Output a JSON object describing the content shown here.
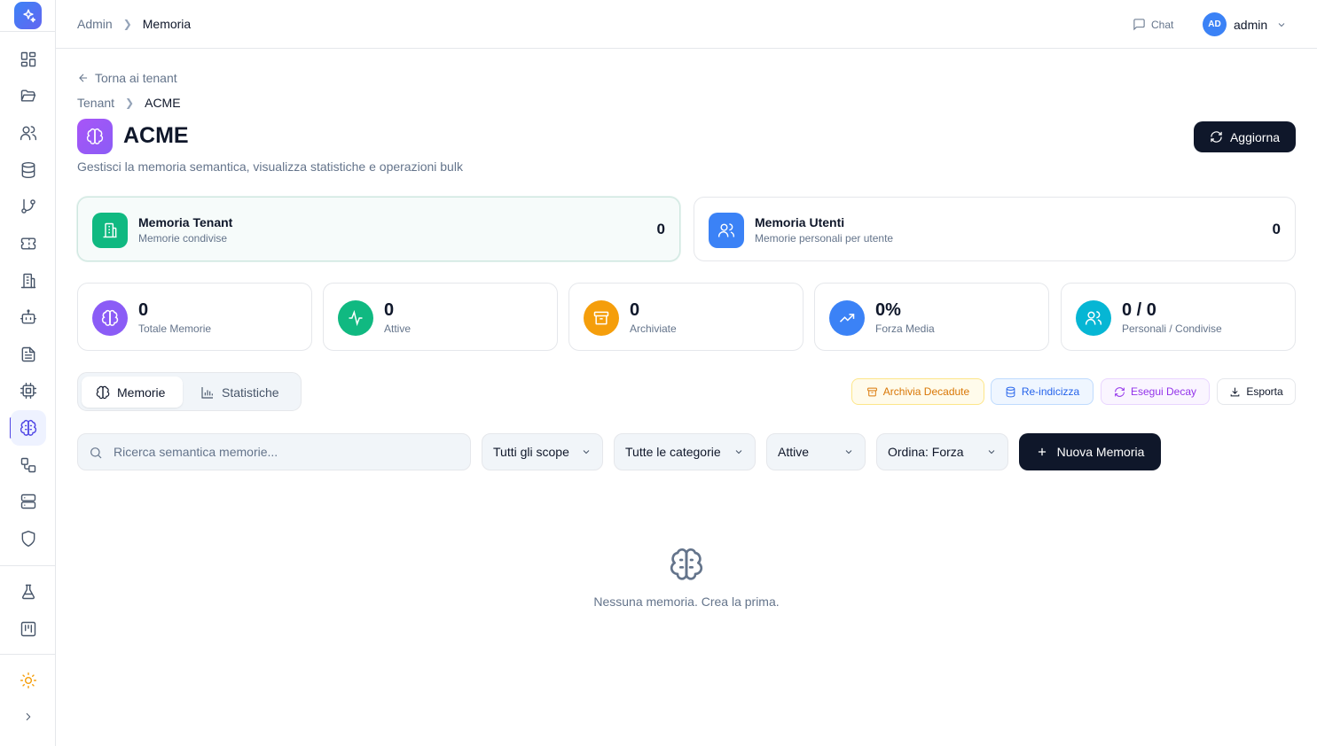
{
  "header": {
    "breadcrumb": [
      "Admin",
      "Memoria"
    ],
    "chat_label": "Chat",
    "user": {
      "initials": "AD",
      "name": "admin"
    }
  },
  "sidebar": {
    "items": [
      "dashboard",
      "projects",
      "users",
      "database",
      "git-branch",
      "tickets",
      "building",
      "bot",
      "documents",
      "chip",
      "memory",
      "workflow",
      "server",
      "shield",
      "lab",
      "kanban",
      "theme",
      "expand"
    ],
    "active": "memory"
  },
  "page": {
    "back_label": "Torna ai tenant",
    "breadcrumb": [
      "Tenant",
      "ACME"
    ],
    "title": "ACME",
    "subtitle": "Gestisci la memoria semantica, visualizza statistiche e operazioni bulk",
    "refresh_label": "Aggiorna"
  },
  "memory_cards": [
    {
      "title": "Memoria Tenant",
      "subtitle": "Memorie condivise",
      "value": "0",
      "color": "#10b981",
      "icon": "building-icon",
      "selected": true
    },
    {
      "title": "Memoria Utenti",
      "subtitle": "Memorie personali per utente",
      "value": "0",
      "color": "#3b82f6",
      "icon": "users-icon",
      "selected": false
    }
  ],
  "stats": [
    {
      "value": "0",
      "label": "Totale Memorie",
      "color": "#8b5cf6",
      "icon": "brain-icon"
    },
    {
      "value": "0",
      "label": "Attive",
      "color": "#10b981",
      "icon": "activity-icon"
    },
    {
      "value": "0",
      "label": "Archiviate",
      "color": "#f59e0b",
      "icon": "archive-icon"
    },
    {
      "value": "0%",
      "label": "Forza Media",
      "color": "#3b82f6",
      "icon": "trending-up-icon"
    },
    {
      "value": "0 / 0",
      "label": "Personali / Condivise",
      "color": "#06b6d4",
      "icon": "users-icon"
    }
  ],
  "tabs": [
    {
      "label": "Memorie",
      "active": true
    },
    {
      "label": "Statistiche",
      "active": false
    }
  ],
  "actions": [
    {
      "label": "Archivia Decadute",
      "color": "#d97706",
      "bg": "#fffbeb",
      "border": "#fde68a"
    },
    {
      "label": "Re-indicizza",
      "color": "#2563eb",
      "bg": "#eff6ff",
      "border": "#bfdbfe"
    },
    {
      "label": "Esegui Decay",
      "color": "#9333ea",
      "bg": "#faf5ff",
      "border": "#e9d5ff"
    },
    {
      "label": "Esporta",
      "color": "#0f172a",
      "bg": "#ffffff",
      "border": "#e5e7eb"
    }
  ],
  "filters": {
    "search_placeholder": "Ricerca semantica memorie...",
    "scope": "Tutti gli scope",
    "category": "Tutte le categorie",
    "status": "Attive",
    "order": "Ordina: Forza",
    "new_label": "Nuova Memoria"
  },
  "empty_state": {
    "text": "Nessuna memoria. Crea la prima."
  }
}
